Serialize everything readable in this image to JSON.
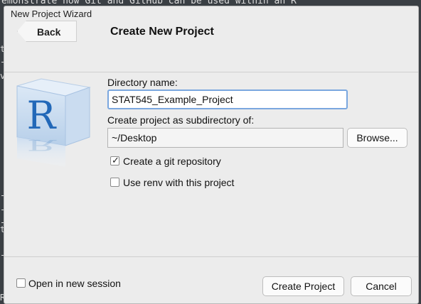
{
  "background": {
    "code_top": "emonstrate how Git and GitHub can be used within an R",
    "gutter_glyphs": [
      "t",
      "-",
      "v",
      "-",
      "-",
      "-",
      "t",
      "-",
      "R"
    ]
  },
  "window": {
    "title": "New Project Wizard"
  },
  "header": {
    "back_label": "Back",
    "page_title": "Create New Project"
  },
  "form": {
    "directory_name_label": "Directory name:",
    "directory_name_value": "STAT545_Example_Project",
    "subdirectory_label": "Create project as subdirectory of:",
    "subdirectory_value": "~/Desktop",
    "browse_label": "Browse...",
    "git_repo_label": "Create a git repository",
    "git_repo_checked": true,
    "renv_label": "Use renv with this project",
    "renv_checked": false
  },
  "footer": {
    "open_new_session_label": "Open in new session",
    "open_new_session_checked": false,
    "create_project_label": "Create Project",
    "cancel_label": "Cancel"
  },
  "icons": {
    "logo": "r-logo-icon",
    "checkmark": "✓"
  },
  "colors": {
    "focus_border": "#7aa7df",
    "r_logo_blue": "#2268b8"
  }
}
